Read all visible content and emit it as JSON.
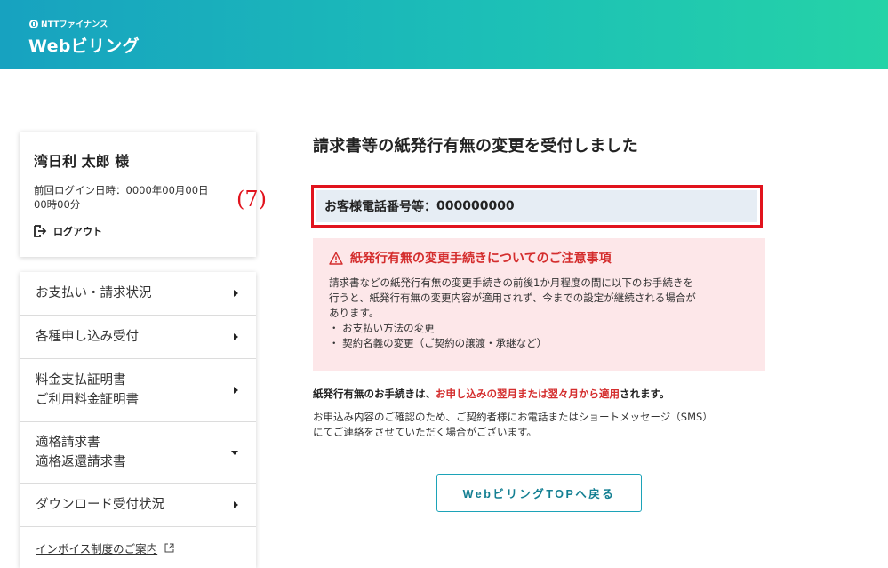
{
  "header": {
    "brand_small": "NTTファイナンス",
    "brand_main": "Webビリング"
  },
  "user": {
    "name": "湾日利 太郎 様",
    "last_login_label": "前回ログイン日時：",
    "last_login_date": "0000年00月00日",
    "last_login_time": "00時00分",
    "logout_label": "ログアウト"
  },
  "menu": {
    "items": [
      {
        "line1": "お支払い・請求状況",
        "line2": "",
        "arrow": "right"
      },
      {
        "line1": "各種申し込み受付",
        "line2": "",
        "arrow": "right"
      },
      {
        "line1": "料金支払証明書",
        "line2": "ご利用料金証明書",
        "arrow": "right"
      },
      {
        "line1": "適格請求書",
        "line2": "適格返還請求書",
        "arrow": "down"
      },
      {
        "line1": "ダウンロード受付状況",
        "line2": "",
        "arrow": "right"
      }
    ],
    "link_label": "インボイス制度のご案内"
  },
  "main": {
    "title": "請求書等の紙発行有無の変更を受付しました",
    "annotation": "(7)",
    "phone_label": "お客様電話番号等：",
    "phone_value": "000000000",
    "notice": {
      "title": "紙発行有無の変更手続きについてのご注意事項",
      "body_line1": "請求書などの紙発行有無の変更手続きの前後1か月程度の間に以下のお手続きを",
      "body_line2": "行うと、紙発行有無の変更内容が適用されず、今までの設定が継続される場合が",
      "body_line3": "あります。",
      "bullet1": "・ お支払い方法の変更",
      "bullet2": "・ 契約名義の変更（ご契約の譲渡・承継など）"
    },
    "info1_a": "紙発行有無のお手続きは、",
    "info1_hl": "お申し込みの翌月または翌々月から適用",
    "info1_b": "されます。",
    "info2_line1": "お申込み内容のご確認のため、ご契約者様にお電話またはショートメッセージ（SMS）",
    "info2_line2": "にてご連絡をさせていただく場合がございます。",
    "top_button": "WebビリングTOPへ戻る"
  },
  "colors": {
    "accent": "#1cbfb7",
    "highlight_red": "#e1131d",
    "notice_bg": "#fde7e9",
    "phone_bg": "#e6edf4"
  }
}
